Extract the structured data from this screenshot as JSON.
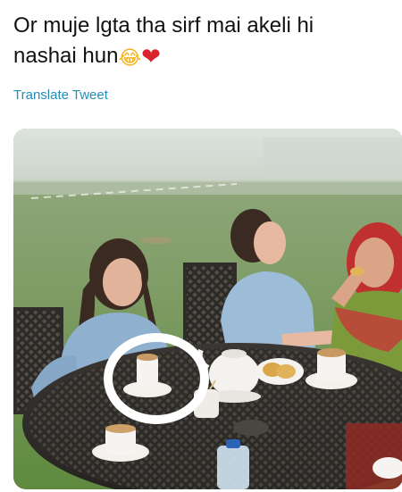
{
  "tweet": {
    "text_line1": "Or muje lgta tha sirf mai akeli hi",
    "text_line2": "nashai hun",
    "emoji_laugh": "😂",
    "emoji_heart": "❤",
    "translate_label": "Translate Tweet"
  },
  "photo": {
    "icon": "image-icon",
    "subject": "three women having tea at an outdoor table on a foggy lawn, one cup circled"
  },
  "colors": {
    "link": "#1f8fb8",
    "text": "#111111",
    "heart": "#d9232d"
  }
}
